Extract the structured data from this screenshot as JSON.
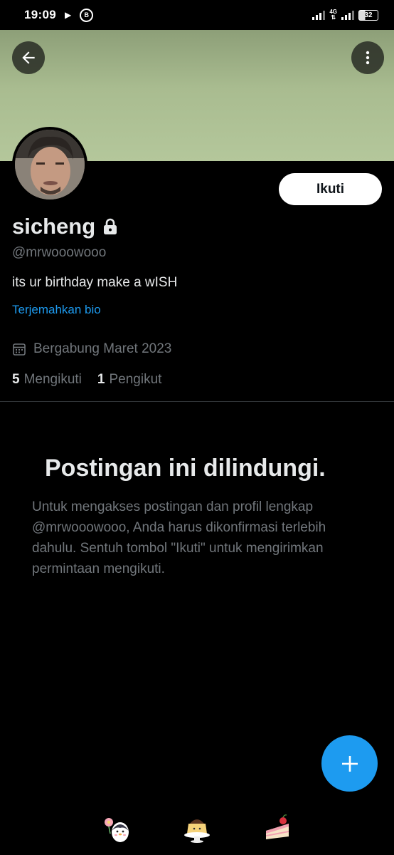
{
  "status_bar": {
    "time": "19:09",
    "battery": "32",
    "network": "4G"
  },
  "profile": {
    "name": "sicheng",
    "handle": "@mrwooowooo",
    "bio": "its ur birthday make a wISH",
    "translate_bio": "Terjemahkan bio",
    "joined": "Bergabung Maret 2023",
    "following_count": "5",
    "following_label": "Mengikuti",
    "followers_count": "1",
    "followers_label": "Pengikut",
    "follow_button": "Ikuti",
    "protected_icon": "lock-icon"
  },
  "protected_notice": {
    "title": "Postingan ini dilindungi.",
    "body": "Untuk mengakses postingan dan profil lengkap @mrwooowooo, Anda harus dikonfirmasi terlebih dahulu. Sentuh tombol \"Ikuti\" untuk mengirimkan permintaan mengikuti."
  },
  "colors": {
    "accent": "#1d9bf0",
    "banner": "#a9bc90",
    "background": "#000000",
    "secondary_text": "#71767b"
  },
  "icons": {
    "back": "arrow-left-icon",
    "more": "more-vertical-icon",
    "calendar": "calendar-icon",
    "compose": "plus-icon",
    "decorations": [
      "penguin-sticker-icon",
      "pudding-sticker-icon",
      "cake-sticker-icon"
    ]
  }
}
